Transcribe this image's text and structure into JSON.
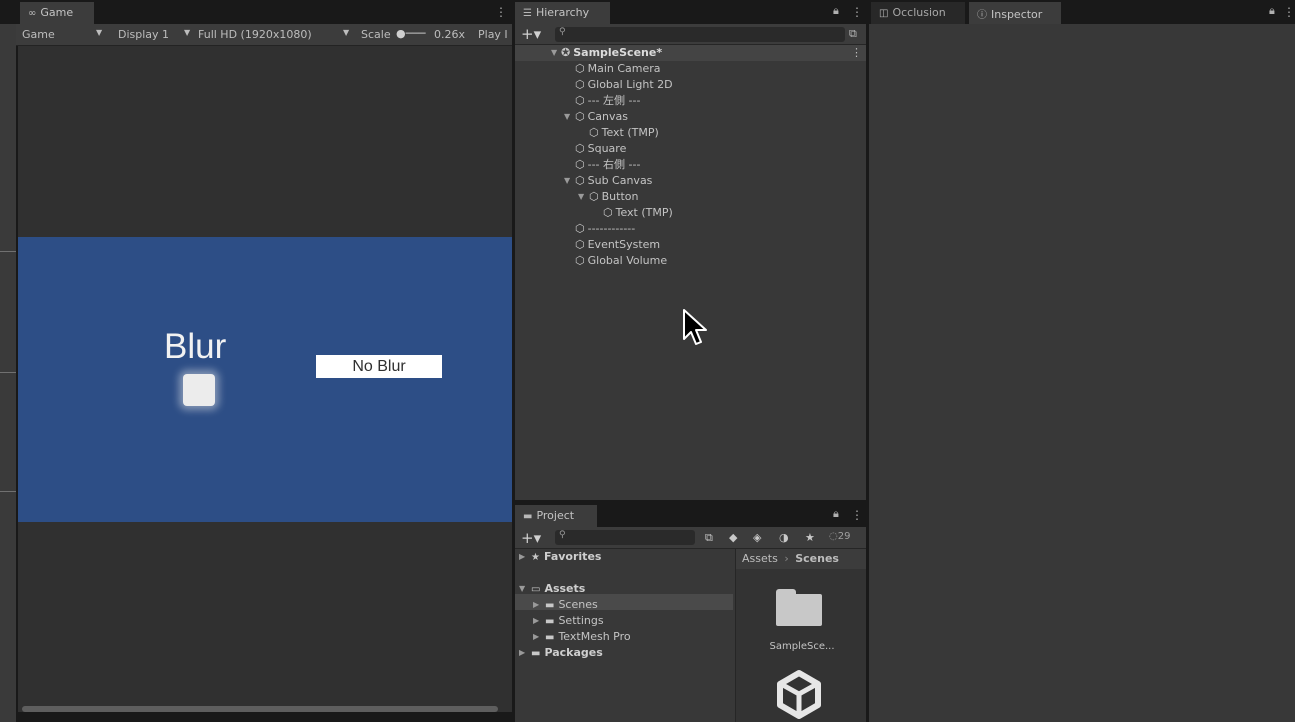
{
  "game": {
    "tab_label": "Game",
    "toolbar": {
      "mode": "Game",
      "display": "Display 1",
      "resolution": "Full HD (1920x1080)",
      "scale_label": "Scale",
      "scale_value": "0.26x",
      "play_label": "Play I"
    },
    "view": {
      "blur_label": "Blur",
      "no_blur_button": "No Blur",
      "canvas_color": "#2d4e86"
    }
  },
  "hierarchy": {
    "tab_label": "Hierarchy",
    "scene_name": "SampleScene*",
    "items": [
      {
        "label": "Main Camera"
      },
      {
        "label": "Global Light 2D"
      },
      {
        "label": "--- 左側 ---"
      },
      {
        "label": "Canvas"
      },
      {
        "label": "Text (TMP)"
      },
      {
        "label": "Square"
      },
      {
        "label": "--- 右側 ---"
      },
      {
        "label": "Sub Canvas"
      },
      {
        "label": "Button"
      },
      {
        "label": "Text (TMP)"
      },
      {
        "label": "------------"
      },
      {
        "label": "EventSystem"
      },
      {
        "label": "Global Volume"
      }
    ]
  },
  "inspector": {
    "tabs": [
      {
        "label": "Occlusion"
      },
      {
        "label": "Inspector"
      }
    ]
  },
  "project": {
    "tab_label": "Project",
    "hidden_count": "29",
    "favorites_label": "Favorites",
    "assets_label": "Assets",
    "tree": [
      {
        "label": "Scenes"
      },
      {
        "label": "Settings"
      },
      {
        "label": "TextMesh Pro"
      }
    ],
    "packages_label": "Packages",
    "breadcrumb": [
      "Assets",
      "Scenes"
    ],
    "asset_items": [
      {
        "label": "SampleSce..."
      }
    ]
  }
}
